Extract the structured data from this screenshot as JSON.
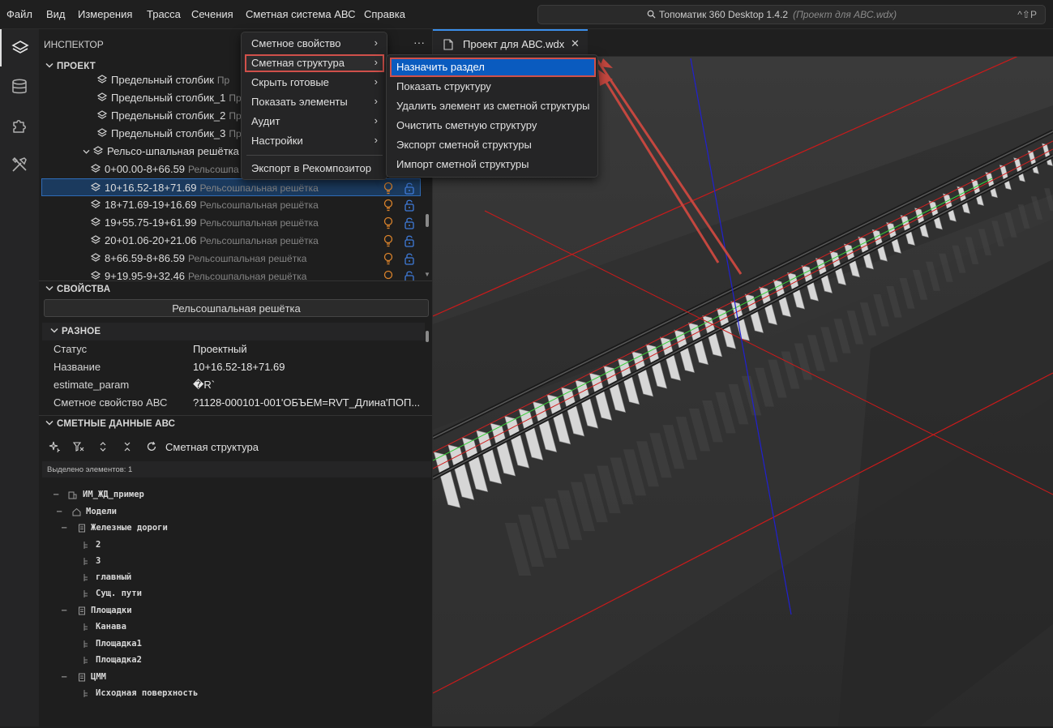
{
  "menubar": {
    "items": [
      "Файл",
      "Вид",
      "Измерения",
      "Трасса",
      "Сечения",
      "Сметная система АВС",
      "Справка"
    ],
    "title": "Топоматик 360 Desktop 1.4.2",
    "project_hint": "(Проект для АВС.wdx)",
    "shortcut": "^⇧P"
  },
  "activity_icons": [
    "layers-icon",
    "database-icon",
    "puzzle-icon",
    "tools-icon"
  ],
  "inspector": {
    "title": "ИНСПЕКТОР",
    "more": "···",
    "project_section": "ПРОЕКТ",
    "tree": [
      {
        "name": "Предельный столбик",
        "type": "Пр"
      },
      {
        "name": "Предельный столбик_1",
        "type": "Пр"
      },
      {
        "name": "Предельный столбик_2",
        "type": "Пр"
      },
      {
        "name": "Предельный столбик_3",
        "type": "Пр"
      },
      {
        "name": "Рельсо-шпальная решётка",
        "type": ""
      },
      {
        "name": "0+00.00-8+66.59",
        "type": "Рельсошпа"
      },
      {
        "name": "10+16.52-18+71.69",
        "type": "Рельсошпальная решётка"
      },
      {
        "name": "18+71.69-19+16.69",
        "type": "Рельсошпальная решётка"
      },
      {
        "name": "19+55.75-19+61.99",
        "type": "Рельсошпальная решётка"
      },
      {
        "name": "20+01.06-20+21.06",
        "type": "Рельсошпальная решётка"
      },
      {
        "name": "8+66.59-8+86.59",
        "type": "Рельсошпальная решётка"
      },
      {
        "name": "9+19.95-9+32.46",
        "type": "Рельсошпальная решётка"
      }
    ],
    "properties_section": "СВОЙСТВА",
    "properties_type": "Рельсошпальная решётка",
    "misc_section": "РАЗНОЕ",
    "properties": [
      {
        "key": "Статус",
        "value": "Проектный"
      },
      {
        "key": "Название",
        "value": "10+16.52-18+71.69"
      },
      {
        "key": "estimate_param",
        "value": "�R`"
      },
      {
        "key": "Сметное свойство АВС",
        "value": "?1128-000101-001'ОБЪЕМ=RVT_Длина'ПОП..."
      }
    ],
    "estimate_section": "СМЕТНЫЕ ДАННЫЕ АВС",
    "estimate_toolbar_label": "Сметная структура",
    "selected_count": "Выделено элементов: 1",
    "estimate_tree": [
      {
        "label": "ИМ_ЖД_пример",
        "level": 0,
        "icon": "building-icon",
        "dash": "–"
      },
      {
        "label": "Модели",
        "level": 1,
        "icon": "home-icon",
        "dash": "–"
      },
      {
        "label": "Железные дороги",
        "level": 2,
        "icon": "document-icon",
        "dash": "–"
      },
      {
        "label": "2",
        "level": 3,
        "icon": "leaf-icon",
        "dash": ""
      },
      {
        "label": "3",
        "level": 3,
        "icon": "leaf-icon",
        "dash": ""
      },
      {
        "label": "главный",
        "level": 3,
        "icon": "leaf-icon",
        "dash": ""
      },
      {
        "label": "Сущ. пути",
        "level": 3,
        "icon": "leaf-icon",
        "dash": ""
      },
      {
        "label": "Площадки",
        "level": 2,
        "icon": "document-icon",
        "dash": "–"
      },
      {
        "label": "Канава",
        "level": 3,
        "icon": "leaf-icon",
        "dash": ""
      },
      {
        "label": "Площадка1",
        "level": 3,
        "icon": "leaf-icon",
        "dash": ""
      },
      {
        "label": "Площадка2",
        "level": 3,
        "icon": "leaf-icon",
        "dash": ""
      },
      {
        "label": "ЦММ",
        "level": 2,
        "icon": "document-icon",
        "dash": "–"
      },
      {
        "label": "Исходная поверхность",
        "level": 3,
        "icon": "leaf-icon",
        "dash": ""
      }
    ]
  },
  "context_menu": {
    "items": [
      "Сметное свойство",
      "Сметная структура",
      "Скрыть готовые",
      "Показать элементы",
      "Аудит",
      "Настройки"
    ],
    "export": "Экспорт в Рекомпозитор",
    "chevron": "›"
  },
  "submenu": {
    "items": [
      "Назначить раздел",
      "Показать структуру",
      "Удалить элемент из сметной структуры",
      "Очистить сметную структуру",
      "Экспорт сметной структуры",
      "Импорт сметной структуры"
    ]
  },
  "editor": {
    "tab_title": "Проект для АВС.wdx",
    "close": "✕"
  },
  "colors": {
    "accent": "#0a5bbf",
    "highlight_border": "#d0504a",
    "bulb": "#d9822b",
    "lock": "#3f7bd9"
  }
}
